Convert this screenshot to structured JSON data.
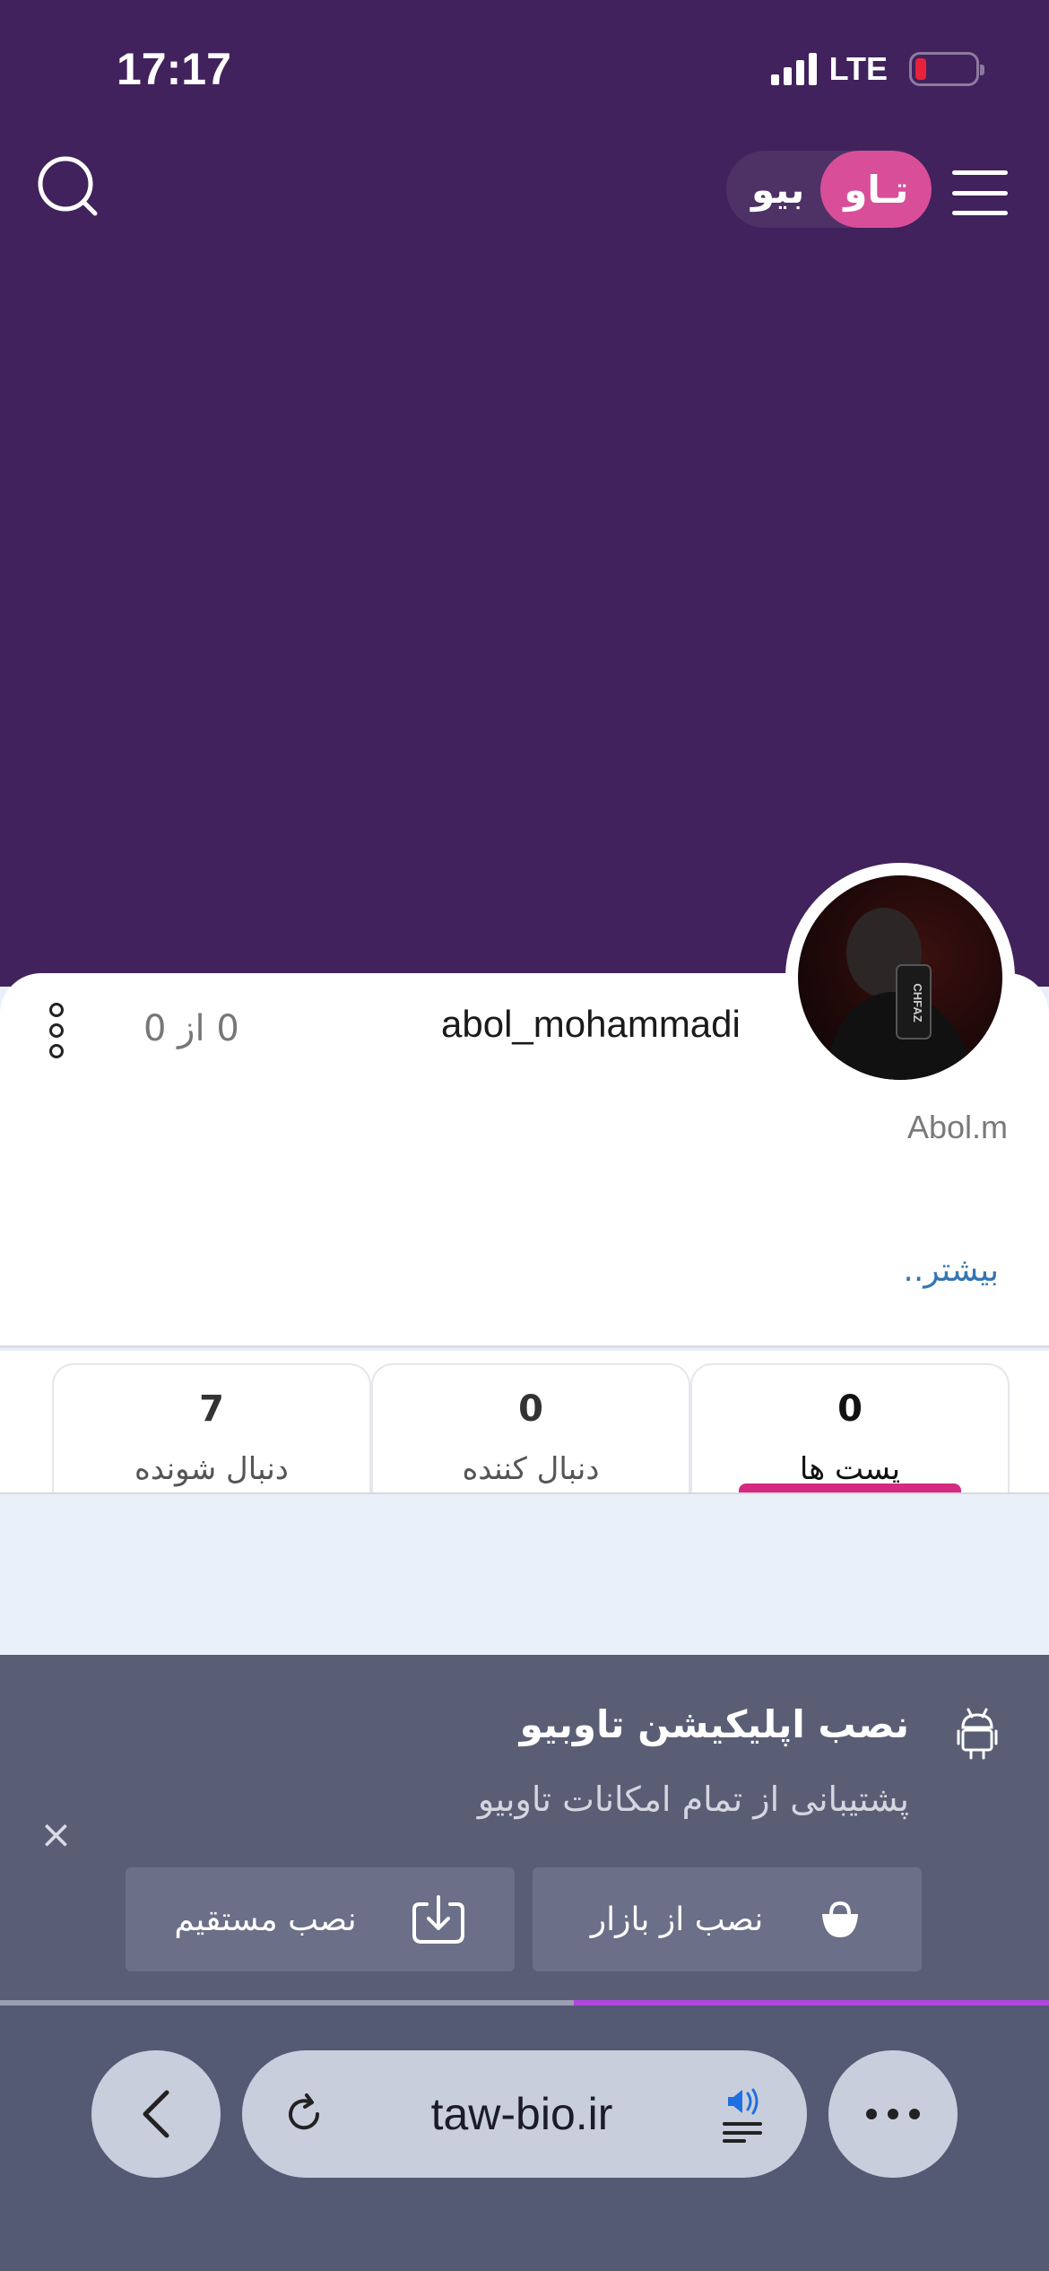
{
  "status_bar": {
    "time": "17:17",
    "network": "LTE",
    "battery_color": "#e8223a"
  },
  "header": {
    "search_icon": "search-icon",
    "logo_left": "بیو",
    "logo_right": "تـاو",
    "menu_icon": "hamburger-menu-icon",
    "background": "#41225c"
  },
  "profile": {
    "username": "abol_mohammadi",
    "display_name": "Abol.m",
    "count_text": "0 از 0",
    "more_link": "بیشتر..",
    "avatar_text": "CHFAZ"
  },
  "stats": [
    {
      "value": "0",
      "label": "پست ها",
      "active": true
    },
    {
      "value": "0",
      "label": "دنبال کننده",
      "active": false
    },
    {
      "value": "7",
      "label": "دنبال شونده",
      "active": false
    }
  ],
  "install_banner": {
    "title": "نصب اپلیکیشن تاوبیو",
    "subtitle": "پشتیبانی از تمام امکانات تاوبیو",
    "close_glyph": "×",
    "bazar_label": "نصب از بازار",
    "direct_label": "نصب مستقیم"
  },
  "browser": {
    "url": "taw-bio.ir"
  }
}
